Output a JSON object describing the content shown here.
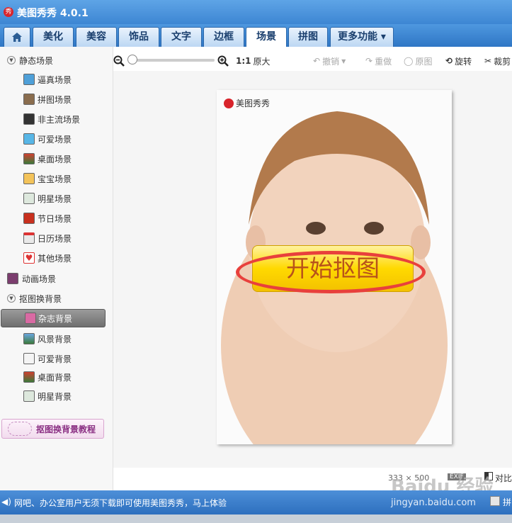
{
  "app": {
    "title": "美图秀秀 4.0.1",
    "logo_glyph": "秀"
  },
  "tabs": [
    {
      "label": "",
      "icon": "home-icon"
    },
    {
      "label": "美化"
    },
    {
      "label": "美容"
    },
    {
      "label": "饰品"
    },
    {
      "label": "文字"
    },
    {
      "label": "边框"
    },
    {
      "label": "场景",
      "active": true
    },
    {
      "label": "拼图"
    },
    {
      "label": "更多功能 ▾"
    }
  ],
  "sidebar": {
    "static_label": "静态场景",
    "static_items": [
      "逼真场景",
      "拼图场景",
      "非主流场景",
      "可爱场景",
      "桌面场景",
      "宝宝场景",
      "明星场景",
      "节日场景",
      "日历场景",
      "其他场景"
    ],
    "animated_label": "动画场景",
    "cutout_label": "抠图换背景",
    "cutout_items": [
      "杂志背景",
      "风景背景",
      "可爱背景",
      "桌面背景",
      "明星背景"
    ],
    "selected": "杂志背景",
    "tutorial_label": "抠图换背景教程"
  },
  "toolbar": {
    "zoom_ratio": "1:1",
    "original_size": "原大",
    "undo": "撤销",
    "redo": "重做",
    "original_image": "原图",
    "rotate": "旋转",
    "crop": "裁剪"
  },
  "canvas": {
    "watermark": "美图秀秀",
    "start_button": "开始抠图",
    "dimensions": "333 × 500",
    "exif": "EXIF",
    "compare": "对比"
  },
  "statusbar": {
    "message": "网吧、办公室用户无须下载即可使用美图秀秀，马上体验",
    "right_label": "拼"
  },
  "watermark_overlay": {
    "brand": "Baidu 经验",
    "url": "jingyan.baidu.com"
  },
  "colors": {
    "title_bar": "#3d86d3",
    "accent_red": "#e8403c",
    "button_yellow": "#ffd900"
  }
}
